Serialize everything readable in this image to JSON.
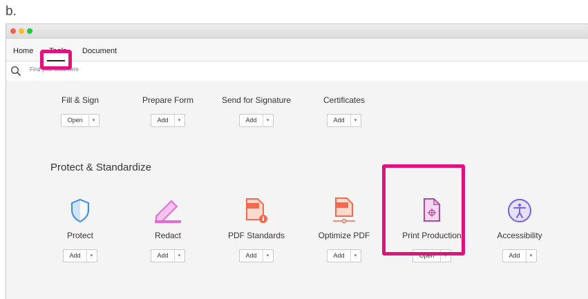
{
  "figure_label": "b.",
  "nav": {
    "tabs": [
      {
        "label": "Home"
      },
      {
        "label": "Tools"
      },
      {
        "label": "Document"
      }
    ]
  },
  "search": {
    "placeholder": "Find your tools here"
  },
  "top_tools": [
    {
      "name": "Fill & Sign",
      "button": "Open"
    },
    {
      "name": "Prepare Form",
      "button": "Add"
    },
    {
      "name": "Send for Signature",
      "button": "Add"
    },
    {
      "name": "Certificates",
      "button": "Add"
    }
  ],
  "section": {
    "title": "Protect & Standardize",
    "tools": [
      {
        "name": "Protect",
        "button": "Add",
        "icon": "shield-icon"
      },
      {
        "name": "Redact",
        "button": "Add",
        "icon": "redact-marker-icon"
      },
      {
        "name": "PDF Standards",
        "button": "Add",
        "icon": "pdf-standards-icon"
      },
      {
        "name": "Optimize PDF",
        "button": "Add",
        "icon": "optimize-pdf-icon"
      },
      {
        "name": "Print Production",
        "button": "Open",
        "icon": "print-production-icon"
      },
      {
        "name": "Accessibility",
        "button": "Add",
        "icon": "accessibility-icon"
      }
    ]
  },
  "caret_glyph": "▾",
  "colors": {
    "highlight": "#e0137c",
    "shield": "#3d8ee6",
    "redact": "#e36bd3",
    "pdf_tools": "#f26b4f",
    "print_production": "#b14a9e",
    "accessibility": "#7a5ee0"
  }
}
